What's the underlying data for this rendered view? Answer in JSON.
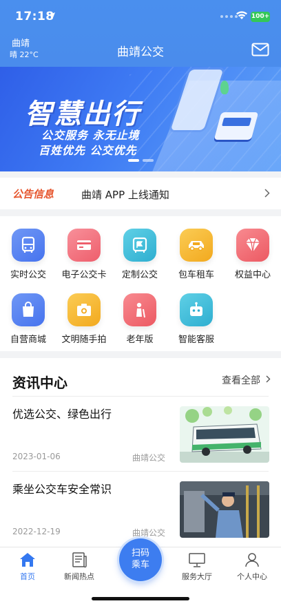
{
  "status": {
    "time": "17:18",
    "battery": "100+"
  },
  "nav": {
    "city": "曲靖",
    "weather": "晴 22°C",
    "title": "曲靖公交"
  },
  "banner": {
    "title": "智慧出行",
    "line1": "公交服务 永无止境",
    "line2": "百姓优先 公交优先"
  },
  "notice": {
    "tag": "公告信息",
    "text": "曲靖 APP 上线通知"
  },
  "services": [
    {
      "label": "实时公交",
      "icon": "bus-icon",
      "color": "#4f7cf0"
    },
    {
      "label": "电子公交卡",
      "icon": "card-icon",
      "color": "#f26d78"
    },
    {
      "label": "定制公交",
      "icon": "custom-bus-icon",
      "color": "#3bb8d6"
    },
    {
      "label": "包车租车",
      "icon": "car-icon",
      "color": "#f5b531"
    },
    {
      "label": "权益中心",
      "icon": "diamond-icon",
      "color": "#f2656c"
    },
    {
      "label": "自营商城",
      "icon": "shopping-bag-icon",
      "color": "#4f7cf0"
    },
    {
      "label": "文明随手拍",
      "icon": "camera-icon",
      "color": "#f5b531"
    },
    {
      "label": "老年版",
      "icon": "elderly-icon",
      "color": "#f2656c"
    },
    {
      "label": "智能客服",
      "icon": "robot-icon",
      "color": "#3bb8d6"
    }
  ],
  "news": {
    "header": "资讯中心",
    "more": "查看全部",
    "items": [
      {
        "title": "优选公交、绿色出行",
        "date": "2023-01-06",
        "source": "曲靖公交"
      },
      {
        "title": "乘坐公交车安全常识",
        "date": "2022-12-19",
        "source": "曲靖公交"
      }
    ]
  },
  "tabbar": {
    "home": "首页",
    "news": "新闻热点",
    "scan_line1": "扫码",
    "scan_line2": "乘车",
    "service": "服务大厅",
    "profile": "个人中心"
  }
}
